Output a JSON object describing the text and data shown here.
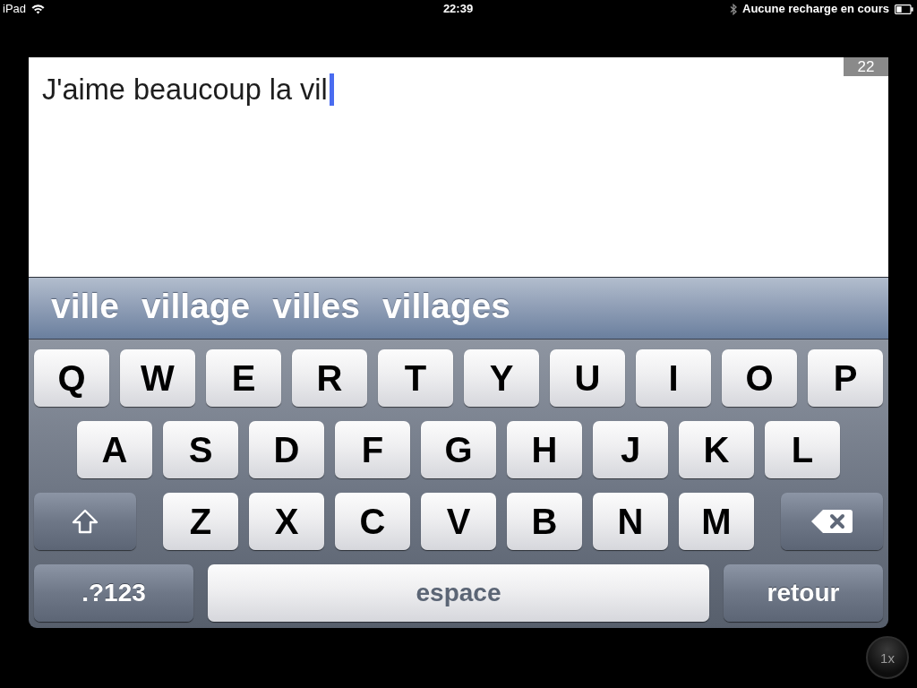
{
  "status_bar": {
    "device": "iPad",
    "time": "22:39",
    "charging_status": "Aucune recharge en cours"
  },
  "editor": {
    "text": "J'aime beaucoup la vil",
    "character_count": "22"
  },
  "suggestions": [
    "ville",
    "village",
    "villes",
    "villages"
  ],
  "keyboard": {
    "key_lines": [
      {
        "keys": [
          {
            "kind": "letter",
            "label": "Q"
          },
          {
            "kind": "letter",
            "label": "W"
          },
          {
            "kind": "letter",
            "label": "E"
          },
          {
            "kind": "letter",
            "label": "R"
          },
          {
            "kind": "letter",
            "label": "T"
          },
          {
            "kind": "letter",
            "label": "Y"
          },
          {
            "kind": "letter",
            "label": "U"
          },
          {
            "kind": "letter",
            "label": "I"
          },
          {
            "kind": "letter",
            "label": "O"
          },
          {
            "kind": "letter",
            "label": "P"
          }
        ]
      },
      {
        "keys": [
          {
            "kind": "letter",
            "label": "A"
          },
          {
            "kind": "letter",
            "label": "S"
          },
          {
            "kind": "letter",
            "label": "D"
          },
          {
            "kind": "letter",
            "label": "F"
          },
          {
            "kind": "letter",
            "label": "G"
          },
          {
            "kind": "letter",
            "label": "H"
          },
          {
            "kind": "letter",
            "label": "J"
          },
          {
            "kind": "letter",
            "label": "K"
          },
          {
            "kind": "letter",
            "label": "L"
          }
        ]
      },
      {
        "keys": [
          {
            "kind": "shift"
          },
          {
            "kind": "letter",
            "label": "Z"
          },
          {
            "kind": "letter",
            "label": "X"
          },
          {
            "kind": "letter",
            "label": "C"
          },
          {
            "kind": "letter",
            "label": "V"
          },
          {
            "kind": "letter",
            "label": "B"
          },
          {
            "kind": "letter",
            "label": "N"
          },
          {
            "kind": "letter",
            "label": "M"
          },
          {
            "kind": "delete"
          }
        ]
      },
      {
        "keys": [
          {
            "kind": "mode",
            "label": ".?123"
          },
          {
            "kind": "space",
            "label": "espace"
          },
          {
            "kind": "return",
            "label": "retour"
          }
        ]
      }
    ]
  },
  "zoom_button": {
    "label": "1x"
  }
}
